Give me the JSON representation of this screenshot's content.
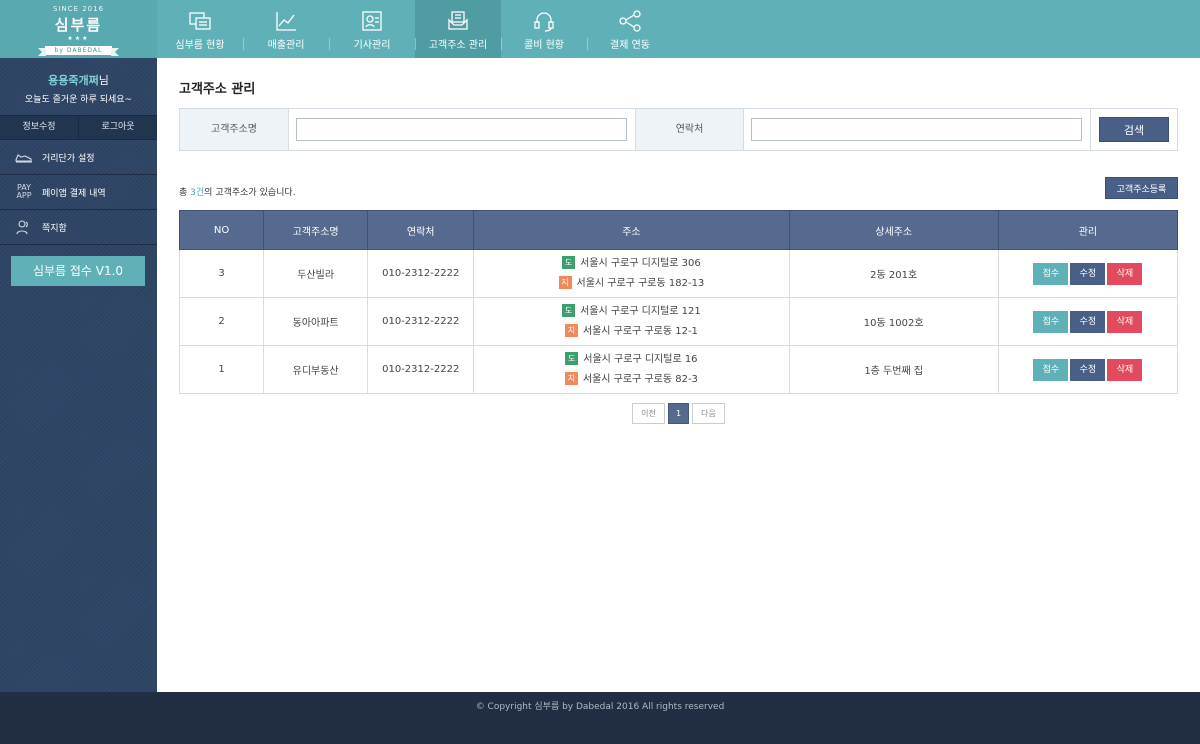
{
  "logo": {
    "since": "SINCE 2016",
    "name": "심부름",
    "stars": "★★★",
    "ribbon": "by DABEDAL"
  },
  "nav": [
    {
      "label": "심부름 현황",
      "icon": "chat-list-icon",
      "active": false
    },
    {
      "label": "매출관리",
      "icon": "line-chart-icon",
      "active": false
    },
    {
      "label": "기사관리",
      "icon": "id-card-icon",
      "active": false
    },
    {
      "label": "고객주소 관리",
      "icon": "inbox-icon",
      "active": true
    },
    {
      "label": "콜비 현황",
      "icon": "headset-icon",
      "active": false
    },
    {
      "label": "결제 연동",
      "icon": "share-nodes-icon",
      "active": false
    }
  ],
  "sidebar": {
    "nickname": "용용죽개쩌",
    "nickname_suffix": "님",
    "greeting": "오늘도 즐거운 하루 되세요~",
    "profile_edit": "정보수정",
    "logout": "로그아웃",
    "menu": [
      {
        "label": "거리단가 설정",
        "icon": "shoe-icon"
      },
      {
        "label": "페이앱 결제 내역",
        "icon": "payapp-icon"
      },
      {
        "label": "쪽지함",
        "icon": "users-icon"
      }
    ],
    "version_button": "심부름 접수 V1.0"
  },
  "main": {
    "title": "고객주소 관리",
    "search": {
      "name_label": "고객주소명",
      "name_value": "",
      "phone_label": "연락처",
      "phone_value": "",
      "button": "검색"
    },
    "count_prefix": "총 ",
    "count_value": "3건",
    "count_suffix": "의 고객주소가 있습니다.",
    "register_button": "고객주소등록",
    "table": {
      "headers": [
        "NO",
        "고객주소명",
        "연락처",
        "주소",
        "상세주소",
        "관리"
      ],
      "rows": [
        {
          "no": "3",
          "name": "두산빌라",
          "phone": "010-2312-2222",
          "road_tag": "도",
          "road": "서울시 구로구 디지털로 306",
          "lot_tag": "지",
          "lot": "서울시 구로구 구로동 182-13",
          "detail": "2동 201호"
        },
        {
          "no": "2",
          "name": "동아아파트",
          "phone": "010-2312-2222",
          "road_tag": "도",
          "road": "서울시 구로구 디지털로 121",
          "lot_tag": "지",
          "lot": "서울시 구로구 구로동 12-1",
          "detail": "10동 1002호"
        },
        {
          "no": "1",
          "name": "유디부동산",
          "phone": "010-2312-2222",
          "road_tag": "도",
          "road": "서울시 구로구 디지털로 16",
          "lot_tag": "지",
          "lot": "서울시 구로구 구로동 82-3",
          "detail": "1층 두번째 집"
        }
      ],
      "actions": {
        "accept": "접수",
        "edit": "수정",
        "delete": "삭제"
      }
    },
    "pager": {
      "prev": "이전",
      "current": "1",
      "next": "다음"
    }
  },
  "footer": {
    "text": "© Copyright 심부름 by Dabedal 2016 All rights reserved"
  },
  "colors": {
    "accent": "#5fb0b7",
    "navy": "#4a5f87",
    "header_row": "#56698f",
    "danger": "#e24b5e",
    "sidebar": "#2f4566"
  }
}
